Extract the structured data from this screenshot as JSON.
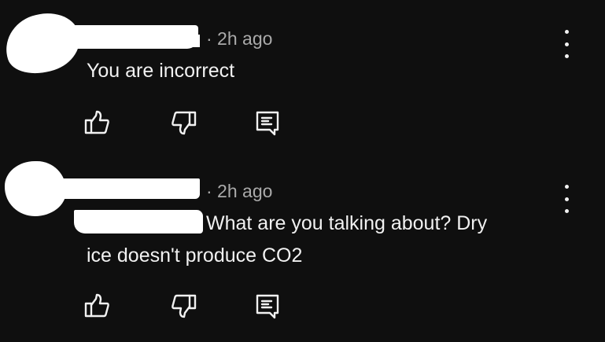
{
  "comments": [
    {
      "time_label": "· 2h ago",
      "text": "You are incorrect",
      "icons": {
        "like": "thumbs-up-icon",
        "dislike": "thumbs-down-icon",
        "reply": "reply-icon",
        "menu": "more-vert-icon"
      }
    },
    {
      "time_label": "· 2h ago",
      "text": "What are you talking about? Dry",
      "text_line2": "ice doesn't produce CO2",
      "icons": {
        "like": "thumbs-up-icon",
        "dislike": "thumbs-down-icon",
        "reply": "reply-icon",
        "menu": "more-vert-icon"
      }
    }
  ],
  "colors": {
    "background": "#0f0f0f",
    "text": "#f1f1f1",
    "meta": "#aaaaaa",
    "redaction": "#ffffff"
  }
}
